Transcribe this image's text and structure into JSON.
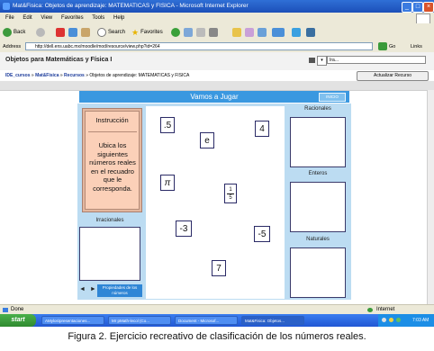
{
  "window": {
    "title": "Mat&Fisica: Objetos de aprendizaje: MATEMATICAS y FISICA - Microsoft Internet Explorer",
    "min_symbol": "_",
    "max_symbol": "□",
    "close_symbol": "×"
  },
  "menu": [
    "File",
    "Edit",
    "View",
    "Favorites",
    "Tools",
    "Help"
  ],
  "toolbar": {
    "back": "Back",
    "search": "Search",
    "favorites": "Favorites"
  },
  "address": {
    "label": "Address",
    "url": "http://dell.ens.uabc.mx/moodle/mod/resource/view.php?id=264",
    "go": "Go",
    "links": "Links"
  },
  "moodle": {
    "course_title": "Objetos para Matemáticas y Física I",
    "jump_value": "Ira...",
    "breadcrumb": {
      "home": "IDE_cursos",
      "sep": "»",
      "course": "Mat&Fisica",
      "resources": "Recursos",
      "current": "Objetos de aprendizaje: MATEMATICAS y FISICA"
    },
    "update_button": "Actualizar Recurso"
  },
  "game": {
    "header": "Vamos a Jugar",
    "start_button": "INICIO",
    "instruction_title": "Instrucción",
    "instruction_text": "Ubica los siguientes números reales en el recuadro que le corresponda.",
    "categories": {
      "irrationals": "Irracionales",
      "rationals": "Racionales",
      "integers": "Enteros",
      "naturals": "Naturales"
    },
    "cards": {
      "c_point5": ".5",
      "c_four": "4",
      "c_e": "e",
      "c_pi": "π",
      "c_frac_num": "1",
      "c_frac_den": "5",
      "c_minus3": "-3",
      "c_minus5": "-5",
      "c_seven": "7"
    },
    "prev_arrow": "◄",
    "next_arrow": "►",
    "properties_button": "Propiedades de los números"
  },
  "status": {
    "left": "Done",
    "zone": "Internet"
  },
  "taskbar": {
    "start": "start",
    "tasks": [
      "AMylos\\presentaciones...",
      "Mr pMath-lecol (Co...",
      "Document - Microsof...",
      "Mat&Fisica: Objetos..."
    ],
    "clock": "7:03 AM"
  },
  "caption": "Figura 2. Ejercicio recreativo de clasificación de los números reales."
}
